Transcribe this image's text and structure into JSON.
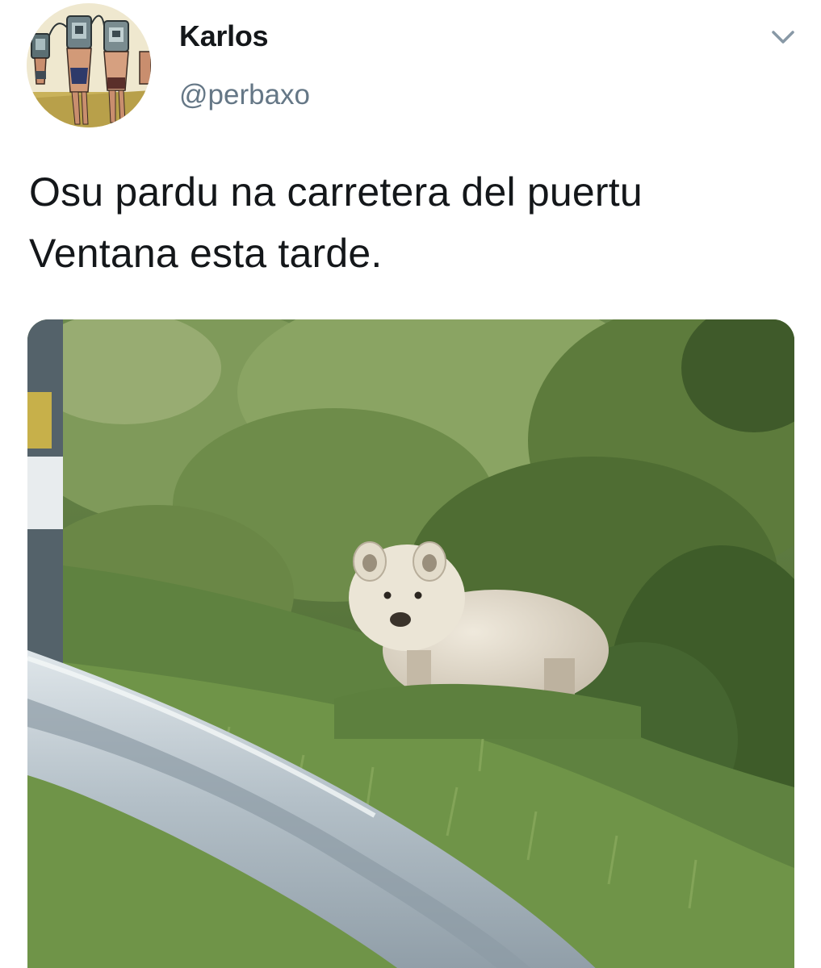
{
  "author": {
    "display_name": "Karlos",
    "handle": "@perbaxo"
  },
  "tweet": {
    "text_line_1": "Osu pardu na carretera del puertu",
    "text_line_2": "Ventana esta tarde."
  },
  "icons": {
    "caret": "chevron-down-icon"
  },
  "colors": {
    "name": "#14171a",
    "handle": "#657786",
    "caret": "#8899a6"
  }
}
